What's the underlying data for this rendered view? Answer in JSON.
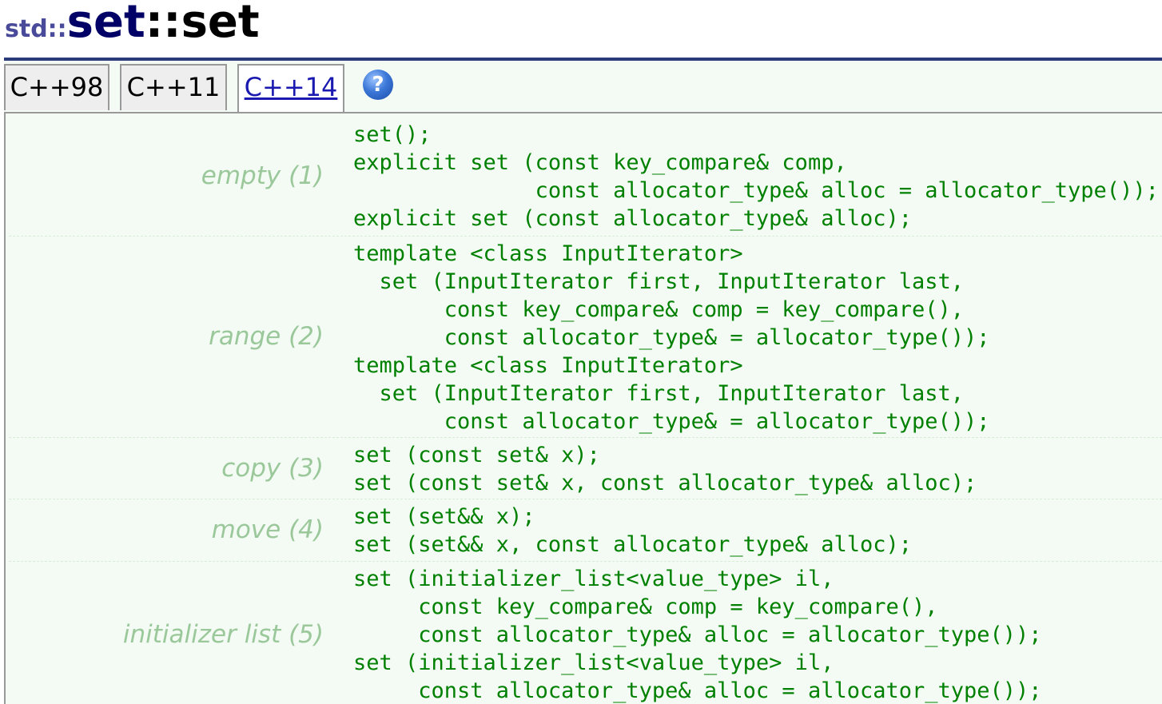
{
  "title": {
    "namespace": "std::",
    "class_name": "set",
    "separator": "::",
    "function_name": "set"
  },
  "tabs": [
    {
      "label": "C++98",
      "active": false
    },
    {
      "label": "C++11",
      "active": false
    },
    {
      "label": "C++14",
      "active": true
    }
  ],
  "help": {
    "glyph": "?",
    "icon": "help-icon"
  },
  "colors": {
    "title_rule": "#2a3a7a",
    "panel_background": "#f4fbf4",
    "label_color": "#9ac89a",
    "code_color": "#008000",
    "active_tab_text": "#1a1ab0"
  },
  "overloads": [
    {
      "label": "empty (1)",
      "code": "set();\nexplicit set (const key_compare& comp,\n              const allocator_type& alloc = allocator_type());\nexplicit set (const allocator_type& alloc);"
    },
    {
      "label": "range (2)",
      "code": "template <class InputIterator>\n  set (InputIterator first, InputIterator last,\n       const key_compare& comp = key_compare(),\n       const allocator_type& = allocator_type());\ntemplate <class InputIterator>\n  set (InputIterator first, InputIterator last,\n       const allocator_type& = allocator_type());"
    },
    {
      "label": "copy (3)",
      "code": "set (const set& x);\nset (const set& x, const allocator_type& alloc);"
    },
    {
      "label": "move (4)",
      "code": "set (set&& x);\nset (set&& x, const allocator_type& alloc);"
    },
    {
      "label": "initializer list (5)",
      "code": "set (initializer_list<value_type> il,\n     const key_compare& comp = key_compare(),\n     const allocator_type& alloc = allocator_type());\nset (initializer_list<value_type> il,\n     const allocator_type& alloc = allocator_type());"
    }
  ]
}
